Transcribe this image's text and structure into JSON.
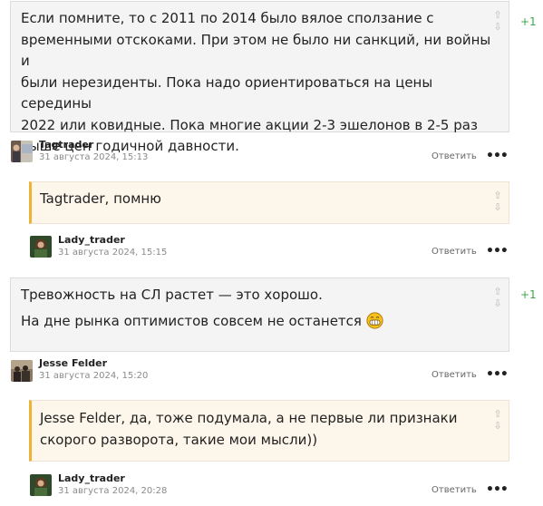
{
  "comments": [
    {
      "text_lines": [
        "Если помните, то с 2011 по 2014 было вялое сползание с",
        "временными отскоками. При этом не было ни санкций, ни войны и",
        "были нерезиденты. Пока надо ориентироваться на цены середины",
        "2022 или ковидные. Пока многие акции 2-3 эшелонов в 2-5 раз",
        "выше цен годичной давности."
      ],
      "vote_up": "⇧",
      "vote_down": "⇩",
      "score": "+1",
      "author": "Tagtrader",
      "date": "31 августа 2024, 15:13",
      "reply_label": "Ответить",
      "more_label": "•••"
    },
    {
      "text_lines": [
        "Tagtrader, помню"
      ],
      "vote_up": "⇧",
      "vote_down": "⇩",
      "author": "Lady_trader",
      "date": "31 августа 2024, 15:15",
      "reply_label": "Ответить",
      "more_label": "•••"
    },
    {
      "paragraph1": "Тревожность на СЛ растет — это хорошо.",
      "paragraph2": "На дне рынка оптимистов совсем не останется",
      "vote_up": "⇧",
      "vote_down": "⇩",
      "score": "+1",
      "author": "Jesse Felder",
      "date": "31 августа 2024, 15:20",
      "reply_label": "Ответить",
      "more_label": "•••"
    },
    {
      "text_lines": [
        "Jesse Felder, да, тоже подумала, а не первые ли признаки",
        "скорого разворота, такие мои мысли))"
      ],
      "vote_up": "⇧",
      "vote_down": "⇩",
      "author": "Lady_trader",
      "date": "31 августа 2024, 20:28",
      "reply_label": "Ответить",
      "more_label": "•••"
    }
  ],
  "colors": {
    "score_green": "#3aa94a",
    "reply_accent": "#f0b232",
    "bubble_bg": "#f4f4f4",
    "reply_bg": "#fdf6ea"
  }
}
